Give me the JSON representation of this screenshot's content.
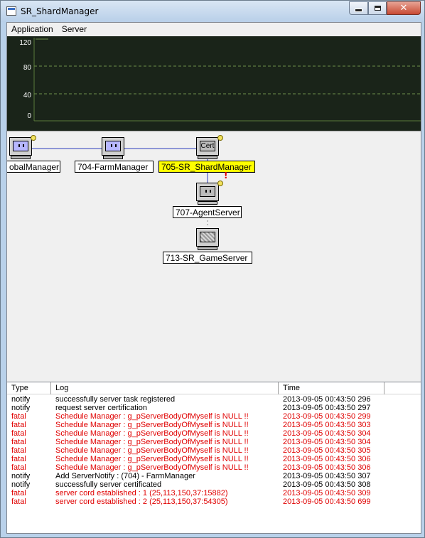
{
  "window": {
    "title": "SR_ShardManager"
  },
  "menu": [
    "Application",
    "Server"
  ],
  "graph": {
    "yticks": [
      "120",
      "80",
      "40",
      "0"
    ],
    "background": "#1a2419"
  },
  "topology": {
    "nodes": [
      {
        "label": "obalManager",
        "screen": "blue",
        "icon": "computer-icon"
      },
      {
        "label": "704-FarmManager",
        "screen": "blue",
        "icon": "computer-icon"
      },
      {
        "label": "705-SR_ShardManager",
        "screen": "cert",
        "cert_text": "Cert",
        "icon": "certified-computer-icon",
        "selected": true
      },
      {
        "label": "707-AgentServer",
        "screen": "gray",
        "icon": "computer-icon"
      },
      {
        "label": "713-SR_GameServer",
        "screen": "hatch",
        "icon": "computer-icon"
      }
    ],
    "highlight_color": "#ffff00"
  },
  "log": {
    "columns": [
      "Type",
      "Log",
      "Time"
    ],
    "rows": [
      {
        "type": "notify",
        "log": "successfully server task registered",
        "time": "2013-09-05 00:43:50 296"
      },
      {
        "type": "notify",
        "log": "request server certification",
        "time": "2013-09-05 00:43:50 297"
      },
      {
        "type": "fatal",
        "log": "Schedule Manager : g_pServerBodyOfMyself is NULL !!",
        "time": "2013-09-05 00:43:50 299"
      },
      {
        "type": "fatal",
        "log": "Schedule Manager : g_pServerBodyOfMyself is NULL !!",
        "time": "2013-09-05 00:43:50 303"
      },
      {
        "type": "fatal",
        "log": "Schedule Manager : g_pServerBodyOfMyself is NULL !!",
        "time": "2013-09-05 00:43:50 304"
      },
      {
        "type": "fatal",
        "log": "Schedule Manager : g_pServerBodyOfMyself is NULL !!",
        "time": "2013-09-05 00:43:50 304"
      },
      {
        "type": "fatal",
        "log": "Schedule Manager : g_pServerBodyOfMyself is NULL !!",
        "time": "2013-09-05 00:43:50 305"
      },
      {
        "type": "fatal",
        "log": "Schedule Manager : g_pServerBodyOfMyself is NULL !!",
        "time": "2013-09-05 00:43:50 306"
      },
      {
        "type": "fatal",
        "log": "Schedule Manager : g_pServerBodyOfMyself is NULL !!",
        "time": "2013-09-05 00:43:50 306"
      },
      {
        "type": "notify",
        "log": "Add ServerNotify : (704) - FarmManager",
        "time": "2013-09-05 00:43:50 307"
      },
      {
        "type": "notify",
        "log": "successfully server certificated",
        "time": "2013-09-05 00:43:50 308"
      },
      {
        "type": "fatal",
        "log": "server cord established : 1 (25,113,150,37:15882)",
        "time": "2013-09-05 00:43:50 309"
      },
      {
        "type": "fatal",
        "log": "server cord established : 2 (25,113,150,37:54305)",
        "time": "2013-09-05 00:43:50 699"
      }
    ],
    "fatal_color": "#e00000"
  }
}
